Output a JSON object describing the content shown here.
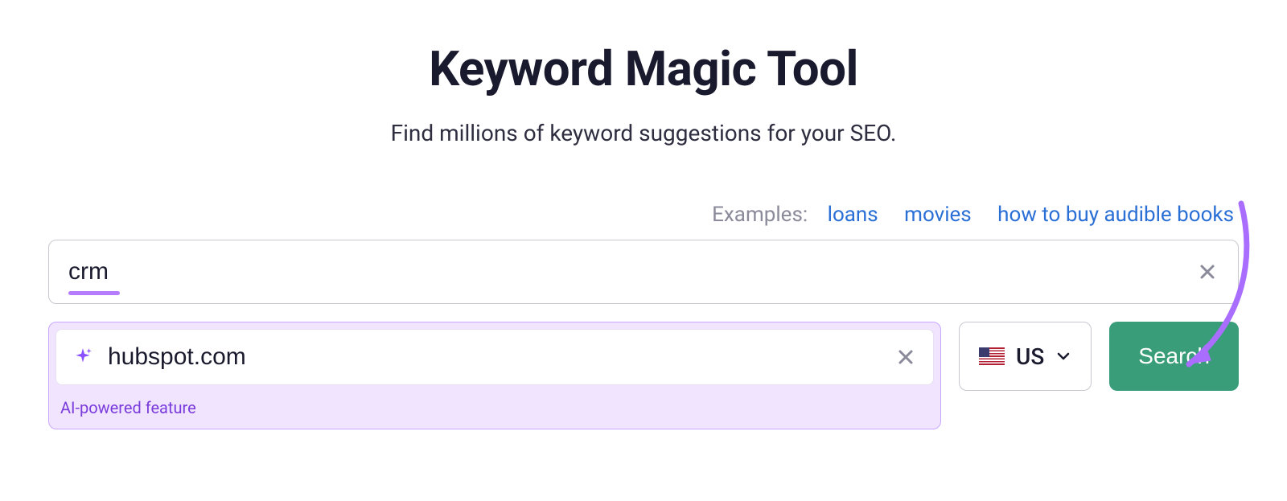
{
  "header": {
    "title": "Keyword Magic Tool",
    "subtitle": "Find millions of keyword suggestions for your SEO."
  },
  "examples": {
    "label": "Examples:",
    "items": [
      "loans",
      "movies",
      "how to buy audible books"
    ]
  },
  "keyword_input": {
    "value": "crm"
  },
  "domain_input": {
    "value": "hubspot.com",
    "ai_label": "AI-powered feature"
  },
  "country": {
    "code": "US"
  },
  "search_button": {
    "label": "Search"
  }
}
